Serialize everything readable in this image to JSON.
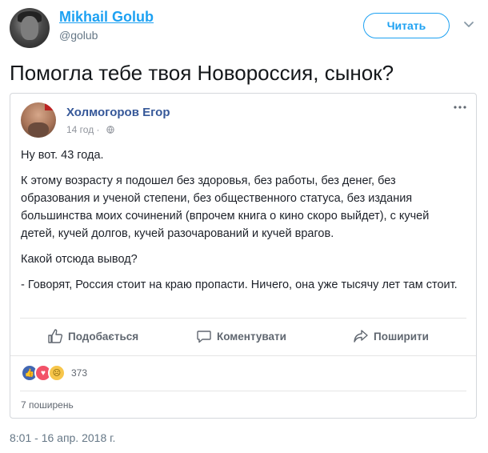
{
  "tweet": {
    "author_name": "Mikhail Golub",
    "author_handle": "@golub",
    "follow_label": "Читать",
    "text": "Помогла тебе твоя Новороссия, сынок?",
    "timestamp": "8:01 - 16 апр. 2018 г."
  },
  "embedded_post": {
    "author": "Холмогоров Егор",
    "time": "14 год ·",
    "paragraphs": [
      "Ну вот. 43 года.",
      "К этому возрасту я подошел без здоровья, без работы, без денег, без образования и ученой степени, без общественного статуса, без издания большинства моих сочинений (впрочем книга о кино скоро выйдет), с кучей детей, кучей долгов, кучей разочарований и кучей врагов.",
      "Какой отсюда вывод?",
      "- Говорят, Россия стоит на краю пропасти. Ничего, она уже тысячу лет там стоит."
    ],
    "actions": {
      "like": "Подобається",
      "comment": "Коментувати",
      "share": "Поширити"
    },
    "reaction_count": "373",
    "shares": "7 поширень"
  },
  "colors": {
    "twitter_blue": "#1da1f2",
    "facebook_name": "#365899",
    "facebook_like": "#4267b2"
  },
  "icons": [
    "caret-down-icon",
    "globe-icon",
    "more-dots-icon",
    "thumbs-up-icon",
    "comment-icon",
    "share-icon"
  ]
}
